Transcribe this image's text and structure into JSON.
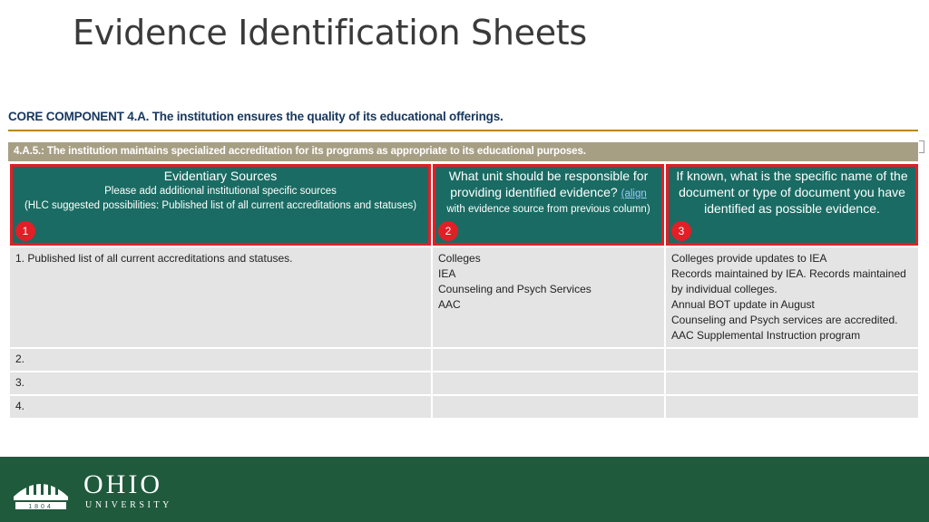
{
  "slide": {
    "title": "Evidence Identification Sheets"
  },
  "document": {
    "core_heading": "CORE COMPONENT 4.A. The institution ensures the quality of its educational offerings.",
    "sub_heading": "4.A.5.: The institution maintains specialized accreditation for its programs as appropriate to its educational purposes.",
    "columns": [
      {
        "badge": "1",
        "title": "Evidentiary Sources",
        "sub1": "Please add additional institutional specific sources",
        "sub2": "(HLC suggested possibilities: Published list of all current accreditations and statuses)"
      },
      {
        "badge": "2",
        "title": "What unit should be responsible for providing identified evidence?",
        "link": "(align",
        "sub": "with evidence source from previous column)"
      },
      {
        "badge": "3",
        "title": "If known, what is the specific name of the document or type of document you have identified as possible evidence."
      }
    ],
    "rows": [
      {
        "source": "1.   Published list of all current accreditations and statuses.",
        "units": [
          "Colleges",
          "IEA",
          "Counseling and Psych Services",
          "AAC"
        ],
        "documents": [
          "Colleges provide updates to IEA",
          "Records maintained by IEA. Records maintained by individual colleges.",
          "Annual BOT update in August",
          "Counseling and Psych services are accredited.",
          "AAC Supplemental Instruction program"
        ]
      },
      {
        "source": "2.",
        "units": [],
        "documents": []
      },
      {
        "source": "3.",
        "units": [],
        "documents": []
      },
      {
        "source": "4.",
        "units": [],
        "documents": []
      }
    ]
  },
  "footer": {
    "logo_name": "OHIO",
    "logo_sub": "UNIVERSITY",
    "seal_year": "1804",
    "seal_icon": "university-seal-icon"
  },
  "colors": {
    "header_teal": "#1a6b63",
    "highlight_red": "#e21f26",
    "footer_green": "#1f5a3c",
    "rule_gold": "#b8860b",
    "subheading_tan": "#a79f84",
    "cell_gray": "#e4e4e4"
  }
}
